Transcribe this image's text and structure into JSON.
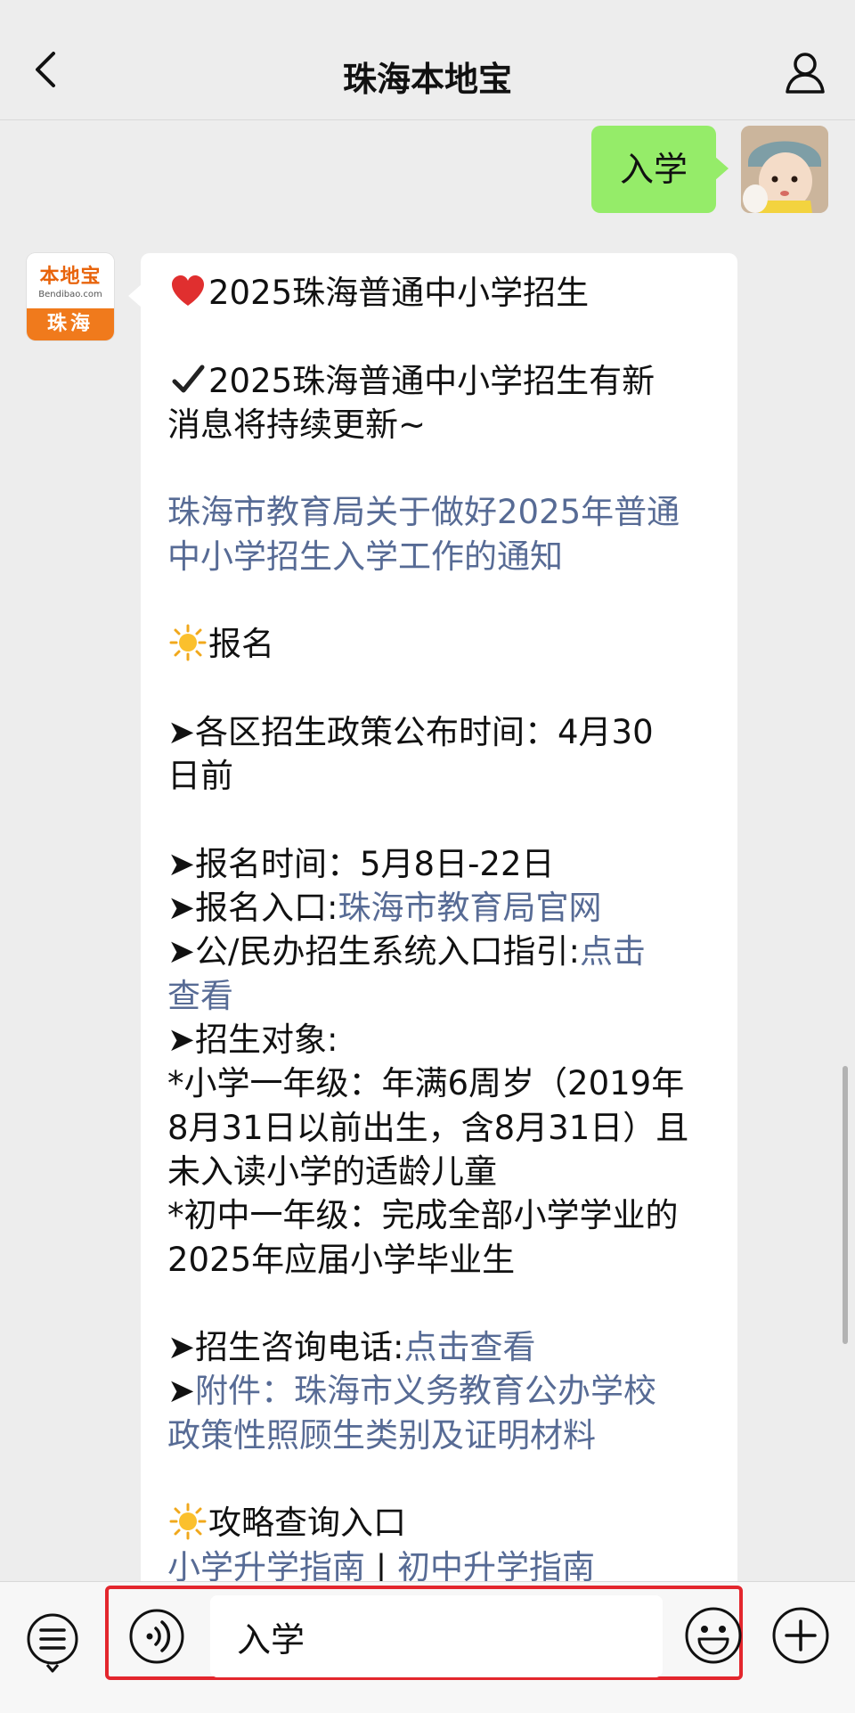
{
  "header": {
    "title": "珠海本地宝"
  },
  "outgoing_message": {
    "text": "入学"
  },
  "bot": {
    "brand": "本地宝",
    "brand_sub": "Bendibao.com",
    "city": "珠海"
  },
  "message": {
    "title": "2025珠海普通中小学招生",
    "update_line1": "2025珠海普通中小学招生有新",
    "update_line2": "消息将持续更新~",
    "notice_link_line1": "珠海市教育局关于做好2025年普通",
    "notice_link_line2": "中小学招生入学工作的通知",
    "section_signup": "报名",
    "policy_line1": "➤各区招生政策公布时间：4月30",
    "policy_line2": "日前",
    "signup_time": "➤报名时间：5月8日-22日",
    "signup_entry_label": "➤报名入口:",
    "signup_entry_link": "珠海市教育局官网",
    "guide_label": "➤公/民办招生系统入口指引:",
    "guide_link_part1": "点击",
    "guide_link_part2": "查看",
    "target_label": "➤招生对象:",
    "primary_line1": "*小学一年级：年满6周岁（2019年",
    "primary_line2": "8月31日以前出生，含8月31日）且",
    "primary_line3": "未入读小学的适龄儿童",
    "junior_line1": "*初中一年级：完成全部小学学业的",
    "junior_line2": "2025年应届小学毕业生",
    "phone_label": "➤招生咨询电话:",
    "phone_link": "点击查看",
    "attachment_label": "➤",
    "attachment_link_line1": "附件：珠海市义务教育公办学校",
    "attachment_link_line2": "政策性照顾生类别及证明材料",
    "section_guides": "攻略查询入口",
    "guide_primary_link": "小学升学指南",
    "guide_separator": " | ",
    "guide_junior_link": "初中升学指南"
  },
  "input_bar": {
    "value": "入学"
  },
  "colors": {
    "accent_green": "#95ec69",
    "link_blue": "#576b95",
    "highlight_red": "#e3262d"
  }
}
